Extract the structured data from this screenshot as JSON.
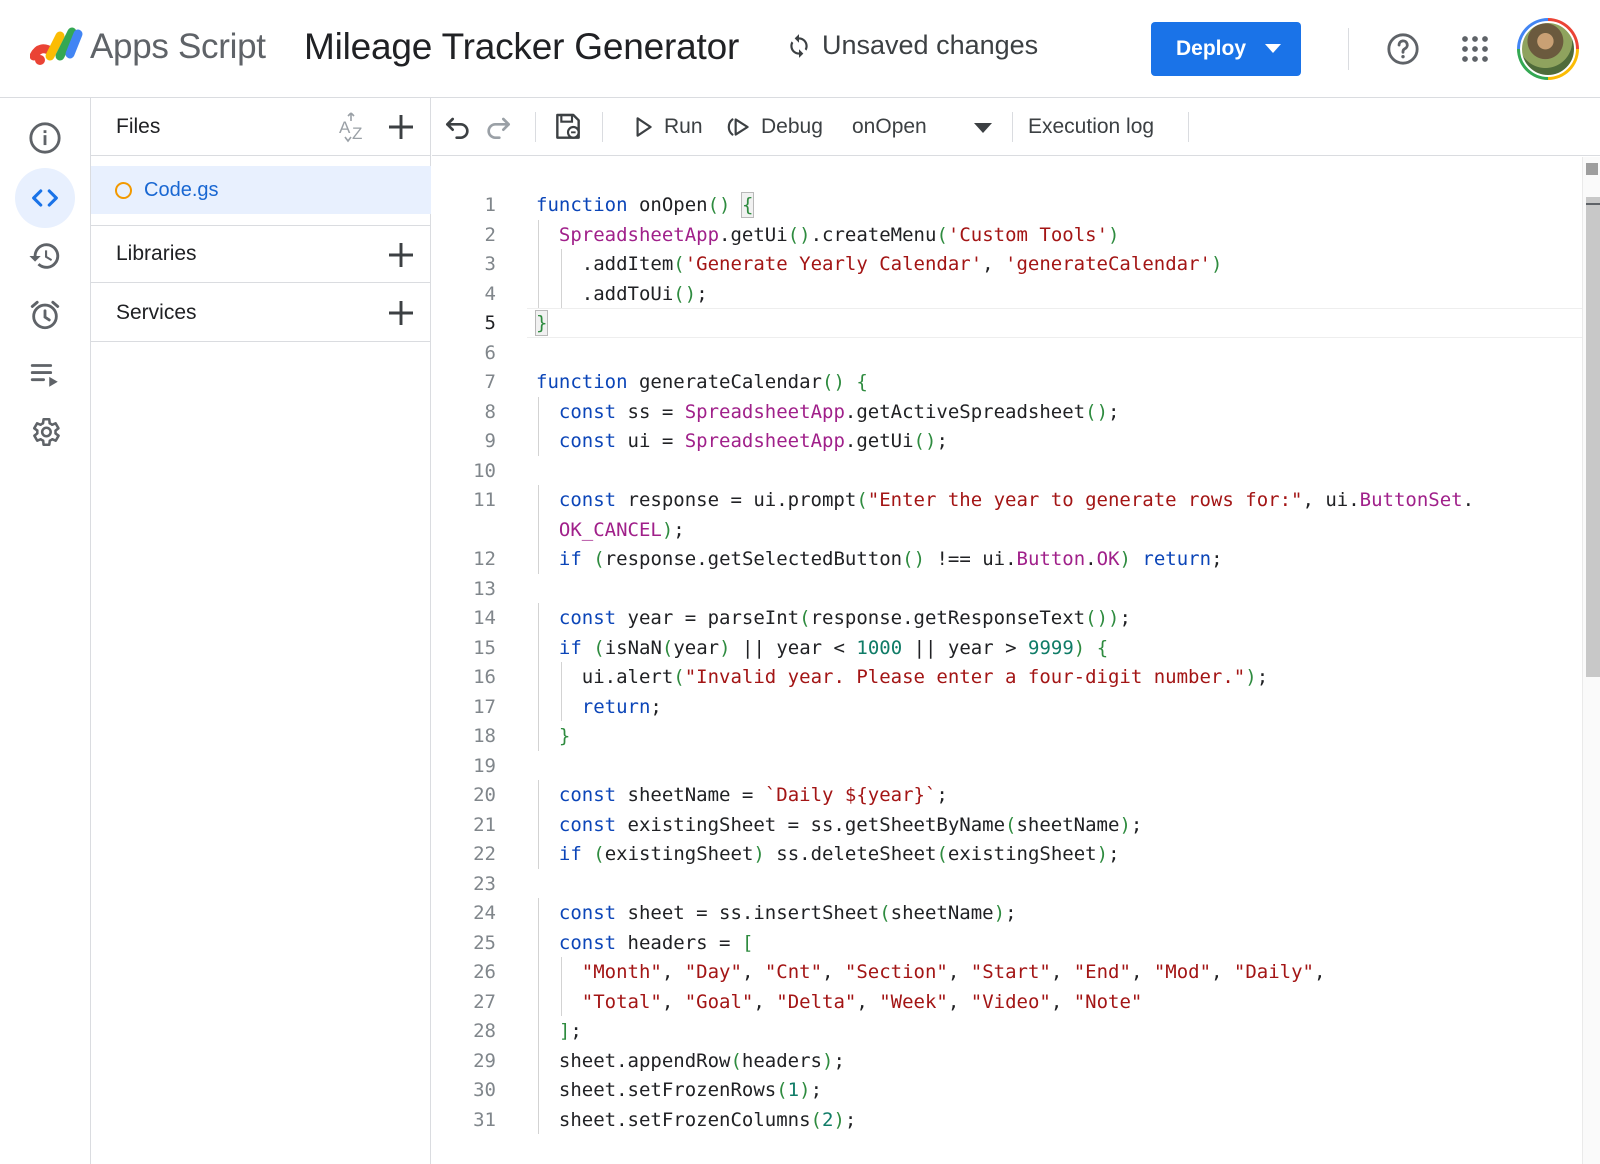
{
  "header": {
    "app_name": "Apps Script",
    "project_title": "Mileage Tracker Generator",
    "save_status": "Unsaved changes",
    "deploy_label": "Deploy"
  },
  "files_panel": {
    "files_title": "Files",
    "files": [
      {
        "name": "Code.gs"
      }
    ],
    "libraries_title": "Libraries",
    "services_title": "Services"
  },
  "toolbar": {
    "run_label": "Run",
    "debug_label": "Debug",
    "selected_function": "onOpen",
    "execution_log_label": "Execution log"
  },
  "editor": {
    "current_line": 5,
    "lines": [
      {
        "no": "1",
        "code": "function onOpen() {"
      },
      {
        "no": "2",
        "code": "  SpreadsheetApp.getUi().createMenu('Custom Tools')"
      },
      {
        "no": "3",
        "code": "    .addItem('Generate Yearly Calendar', 'generateCalendar')"
      },
      {
        "no": "4",
        "code": "    .addToUi();"
      },
      {
        "no": "5",
        "code": "}"
      },
      {
        "no": "6",
        "code": ""
      },
      {
        "no": "7",
        "code": "function generateCalendar() {"
      },
      {
        "no": "8",
        "code": "  const ss = SpreadsheetApp.getActiveSpreadsheet();"
      },
      {
        "no": "9",
        "code": "  const ui = SpreadsheetApp.getUi();"
      },
      {
        "no": "10",
        "code": ""
      },
      {
        "no": "11",
        "code": "  const response = ui.prompt(\"Enter the year to generate rows for:\", ui.ButtonSet."
      },
      {
        "no": "",
        "code": "  OK_CANCEL);"
      },
      {
        "no": "12",
        "code": "  if (response.getSelectedButton() !== ui.Button.OK) return;"
      },
      {
        "no": "13",
        "code": ""
      },
      {
        "no": "14",
        "code": "  const year = parseInt(response.getResponseText());"
      },
      {
        "no": "15",
        "code": "  if (isNaN(year) || year < 1000 || year > 9999) {"
      },
      {
        "no": "16",
        "code": "    ui.alert(\"Invalid year. Please enter a four-digit number.\");"
      },
      {
        "no": "17",
        "code": "    return;"
      },
      {
        "no": "18",
        "code": "  }"
      },
      {
        "no": "19",
        "code": ""
      },
      {
        "no": "20",
        "code": "  const sheetName = `Daily ${year}`;"
      },
      {
        "no": "21",
        "code": "  const existingSheet = ss.getSheetByName(sheetName);"
      },
      {
        "no": "22",
        "code": "  if (existingSheet) ss.deleteSheet(existingSheet);"
      },
      {
        "no": "23",
        "code": ""
      },
      {
        "no": "24",
        "code": "  const sheet = ss.insertSheet(sheetName);"
      },
      {
        "no": "25",
        "code": "  const headers = ["
      },
      {
        "no": "26",
        "code": "    \"Month\", \"Day\", \"Cnt\", \"Section\", \"Start\", \"End\", \"Mod\", \"Daily\","
      },
      {
        "no": "27",
        "code": "    \"Total\", \"Goal\", \"Delta\", \"Week\", \"Video\", \"Note\""
      },
      {
        "no": "28",
        "code": "  ];"
      },
      {
        "no": "29",
        "code": "  sheet.appendRow(headers);"
      },
      {
        "no": "30",
        "code": "  sheet.setFrozenRows(1);"
      },
      {
        "no": "31",
        "code": "  sheet.setFrozenColumns(2);"
      }
    ]
  },
  "colors": {
    "accent": "#1a73e8",
    "keyword": "#0b45b8",
    "string": "#a31515",
    "class": "#a0208a",
    "paren": "#2e8b3f",
    "number": "#107c67",
    "file_dot": "#f29900"
  },
  "icons": {
    "rail": [
      "info-icon",
      "code-icon",
      "history-icon",
      "alarm-icon",
      "executions-icon",
      "settings-icon"
    ],
    "toolbar": [
      "undo-icon",
      "redo-icon",
      "save-icon",
      "play-icon",
      "debug-icon"
    ],
    "header": [
      "apps-script-logo",
      "sync-icon",
      "help-icon",
      "apps-grid-icon"
    ]
  }
}
